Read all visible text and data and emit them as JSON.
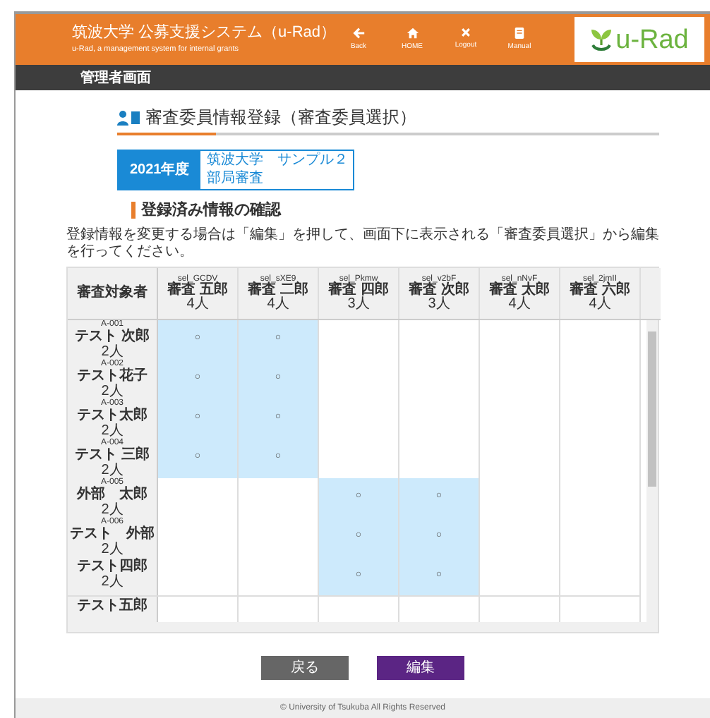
{
  "header": {
    "title": "筑波大学 公募支援システム（u-Rad）",
    "subtitle": "u-Rad, a management system for internal grants",
    "nav": [
      {
        "kind": "back",
        "label": "Back"
      },
      {
        "kind": "home",
        "label": "HOME"
      },
      {
        "kind": "logout",
        "label": "Logout"
      },
      {
        "kind": "manual",
        "label": "Manual"
      }
    ],
    "logo_text": "u-Rad"
  },
  "menu_bar": {
    "label": "管理者画面"
  },
  "page_title": "審査委員情報登録（審査委員選択）",
  "badge": {
    "year": "2021年度",
    "lines": [
      "筑波大学　サンプル２",
      "部局審査"
    ]
  },
  "section": {
    "heading": "登録済み情報の確認",
    "note": "登録情報を変更する場合は「編集」を押して、画面下に表示される「審査委員選択」から編集を行ってください。"
  },
  "table": {
    "corner": "審査対象者",
    "columns": [
      {
        "id": "sel_GCDV",
        "name": "審査 五郎",
        "count": "4人"
      },
      {
        "id": "sel_sXE9",
        "name": "審査 二郎",
        "count": "4人"
      },
      {
        "id": "sel_Pkmw",
        "name": "審査 四郎",
        "count": "3人"
      },
      {
        "id": "sel_v2bF",
        "name": "審査 次郎",
        "count": "3人"
      },
      {
        "id": "sel_nNvF",
        "name": "審査 太郎",
        "count": "4人"
      },
      {
        "id": "sel_2jmII",
        "name": "審査 六郎",
        "count": "4人"
      }
    ],
    "rows": [
      {
        "id": "A-001",
        "name": "テスト 次郎",
        "count": "2人",
        "cells": [
          {
            "selected": true,
            "text": "○"
          },
          {
            "selected": true,
            "text": "○"
          },
          {
            "selected": false
          },
          {
            "selected": false
          },
          {
            "selected": false
          },
          {
            "selected": false
          }
        ]
      },
      {
        "id": "A-002",
        "name": "テスト花子",
        "count": "2人",
        "cells": [
          {
            "selected": true,
            "text": "○"
          },
          {
            "selected": true,
            "text": "○"
          },
          {
            "selected": false
          },
          {
            "selected": false
          },
          {
            "selected": false
          },
          {
            "selected": false
          }
        ]
      },
      {
        "id": "A-003",
        "name": "テスト太郎",
        "count": "2人",
        "cells": [
          {
            "selected": true,
            "text": "○"
          },
          {
            "selected": true,
            "text": "○"
          },
          {
            "selected": false
          },
          {
            "selected": false
          },
          {
            "selected": false
          },
          {
            "selected": false
          }
        ]
      },
      {
        "id": "A-004",
        "name": "テスト 三郎",
        "count": "2人",
        "cells": [
          {
            "selected": true,
            "text": "○"
          },
          {
            "selected": true,
            "text": "○"
          },
          {
            "selected": false
          },
          {
            "selected": false
          },
          {
            "selected": false
          },
          {
            "selected": false
          }
        ]
      },
      {
        "id": "A-005",
        "name": "外部　太郎",
        "count": "2人",
        "cells": [
          {
            "selected": false
          },
          {
            "selected": false
          },
          {
            "selected": true,
            "text": "○"
          },
          {
            "selected": true,
            "text": "○"
          },
          {
            "selected": false
          },
          {
            "selected": false
          }
        ]
      },
      {
        "id": "A-006",
        "name": "テスト　外部",
        "count": "2人",
        "cells": [
          {
            "selected": false
          },
          {
            "selected": false
          },
          {
            "selected": true,
            "text": "○"
          },
          {
            "selected": true,
            "text": "○"
          },
          {
            "selected": false
          },
          {
            "selected": false
          }
        ]
      },
      {
        "name": "テスト四郎",
        "count": "2人",
        "cells": [
          {
            "selected": false
          },
          {
            "selected": false
          },
          {
            "selected": true,
            "text": "○"
          },
          {
            "selected": true,
            "text": "○"
          },
          {
            "selected": false
          },
          {
            "selected": false
          }
        ]
      },
      {
        "name": "テスト五郎",
        "cells": [
          {
            "selected": false
          },
          {
            "selected": false
          },
          {
            "selected": false
          },
          {
            "selected": false
          },
          {
            "selected": false
          },
          {
            "selected": false
          }
        ]
      }
    ]
  },
  "buttons": [
    {
      "kind": "back",
      "label": "戻る"
    },
    {
      "kind": "edit",
      "label": "編集"
    }
  ],
  "footer": "© University of Tsukuba All Rights Reserved"
}
